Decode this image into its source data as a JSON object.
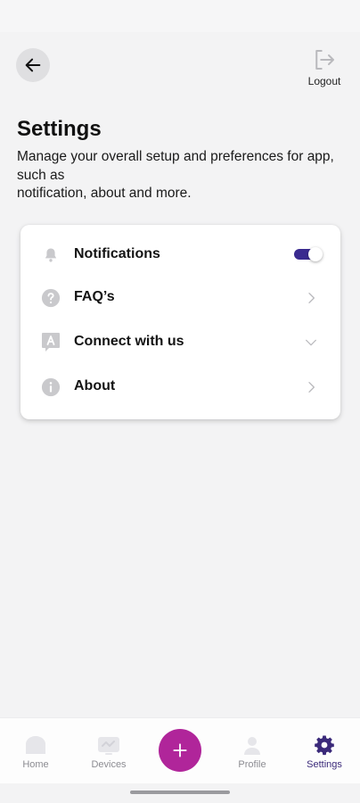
{
  "status_bar": {
    "time": "",
    "icons": ""
  },
  "header": {
    "logout_label": "Logout"
  },
  "page": {
    "title": "Settings",
    "description_line1": "Manage your overall setup and preferences for app, such as",
    "description_line2": "notification, about and more."
  },
  "settings": {
    "items": [
      {
        "label": "Notifications",
        "icon": "bell-icon",
        "trailing": "toggle",
        "toggle_on": true
      },
      {
        "label": "FAQ’s",
        "icon": "question-icon",
        "trailing": "chevron-right-icon"
      },
      {
        "label": "Connect with us",
        "icon": "chat-icon",
        "trailing": "chevron-down-icon"
      },
      {
        "label": "About",
        "icon": "info-icon",
        "trailing": "chevron-right-icon"
      }
    ]
  },
  "bottom_nav": {
    "items": [
      {
        "label": "Home",
        "icon": "home-icon",
        "active": false
      },
      {
        "label": "Devices",
        "icon": "devices-icon",
        "active": false
      },
      {
        "label": "Profile",
        "icon": "profile-icon",
        "active": false
      },
      {
        "label": "Settings",
        "icon": "gear-icon",
        "active": true
      }
    ],
    "fab_icon": "plus-icon"
  },
  "colors": {
    "accent": "#3a2a8f",
    "fab": "#b0259a",
    "background": "#f3f3f4"
  }
}
